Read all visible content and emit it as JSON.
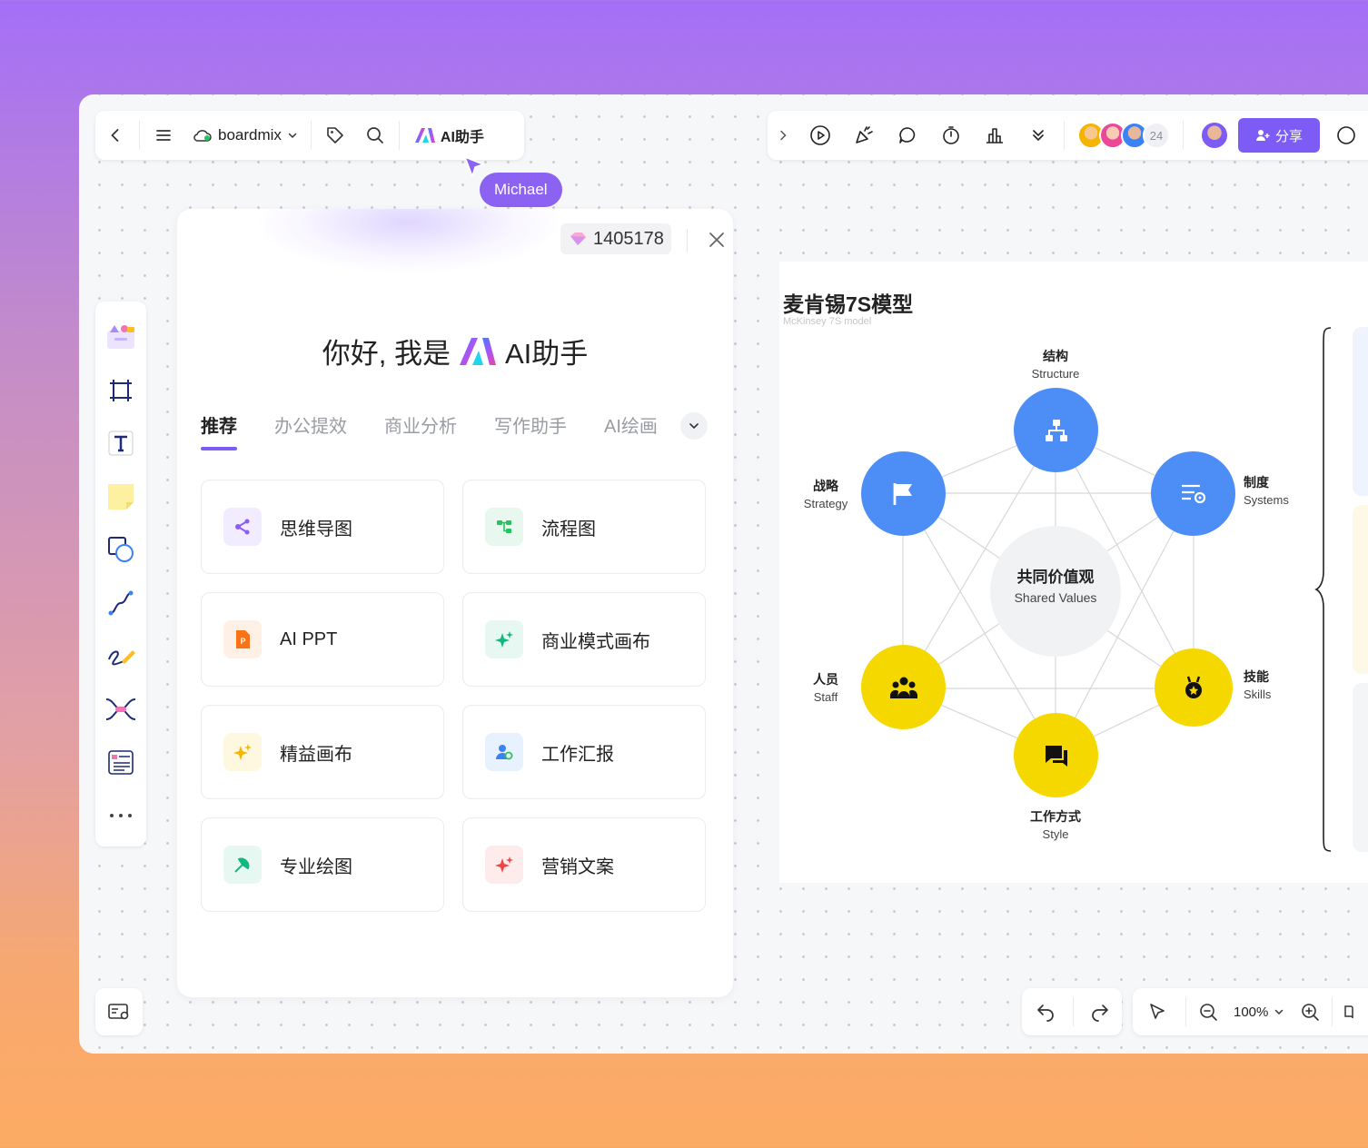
{
  "toolbar": {
    "brand": "boardmix",
    "ai_label": "AI助手",
    "share_label": "分享",
    "collaborator_count": "24"
  },
  "cursor": {
    "name": "Michael"
  },
  "ai_panel": {
    "credits": "1405178",
    "greeting_prefix": "你好, 我是",
    "greeting_suffix": "AI助手",
    "tabs": [
      {
        "label": "推荐",
        "active": true
      },
      {
        "label": "办公提效"
      },
      {
        "label": "商业分析"
      },
      {
        "label": "写作助手"
      },
      {
        "label": "AI绘画"
      }
    ],
    "cards": [
      {
        "label": "思维导图",
        "icon": "mindmap-icon",
        "color": "#8b5cf6",
        "bg": "#f1ecff"
      },
      {
        "label": "流程图",
        "icon": "flowchart-icon",
        "color": "#22c55e",
        "bg": "#e8f8ef"
      },
      {
        "label": "AI PPT",
        "icon": "ppt-icon",
        "color": "#f97316",
        "bg": "#fff0e6"
      },
      {
        "label": "商业模式画布",
        "icon": "sparkle-icon",
        "color": "#10b981",
        "bg": "#e6f8f1"
      },
      {
        "label": "精益画布",
        "icon": "sparkle-icon",
        "color": "#f5b800",
        "bg": "#fff8e0"
      },
      {
        "label": "工作汇报",
        "icon": "report-icon",
        "color": "#3b82f6",
        "bg": "#e8f1fe"
      },
      {
        "label": "专业绘图",
        "icon": "draw-icon",
        "color": "#10b981",
        "bg": "#e6f8f1"
      },
      {
        "label": "营销文案",
        "icon": "sparkle-icon",
        "color": "#ef4444",
        "bg": "#feecec"
      }
    ]
  },
  "board": {
    "title": "麦肯锡7S模型",
    "subtitle": "McKinsey 7S model",
    "center": {
      "zh": "共同价值观",
      "en": "Shared Values"
    },
    "nodes": [
      {
        "zh": "结构",
        "en": "Structure",
        "color": "#4c8df6"
      },
      {
        "zh": "制度",
        "en": "Systems",
        "color": "#4c8df6"
      },
      {
        "zh": "技能",
        "en": "Skills",
        "color": "#f5d800"
      },
      {
        "zh": "工作方式",
        "en": "Style",
        "color": "#f5d800"
      },
      {
        "zh": "人员",
        "en": "Staff",
        "color": "#f5d800"
      },
      {
        "zh": "战略",
        "en": "Strategy",
        "color": "#4c8df6"
      }
    ]
  },
  "zoom": {
    "value": "100%"
  },
  "colors": {
    "accent": "#7c5cf4",
    "blue_node": "#4c8df6",
    "yellow_node": "#f5d800"
  }
}
